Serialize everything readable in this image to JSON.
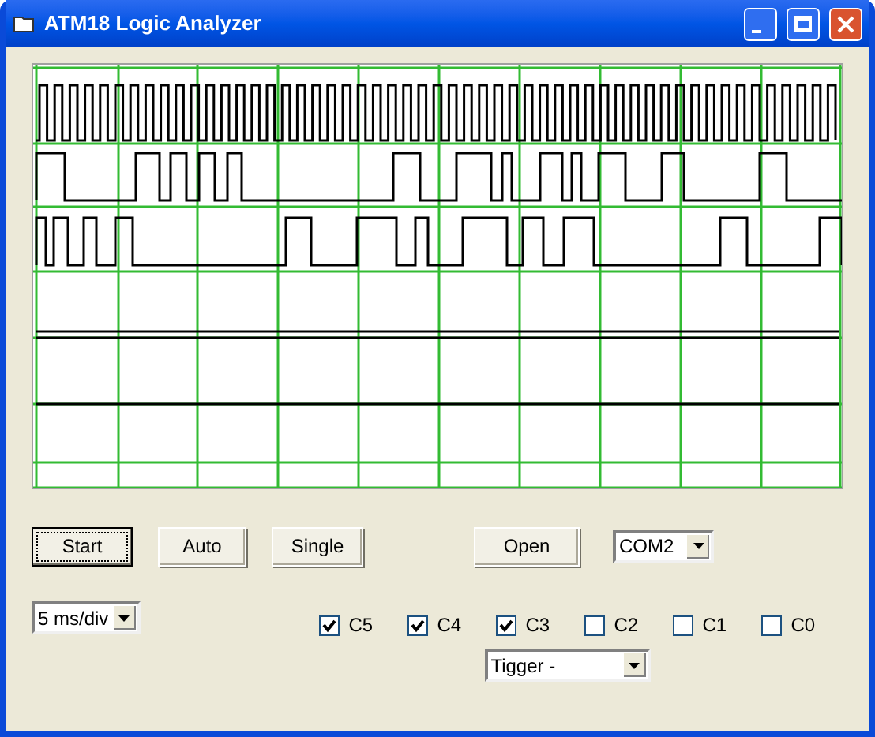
{
  "window": {
    "title": "ATM18 Logic Analyzer"
  },
  "buttons": [
    {
      "label": "Start",
      "focused": true
    },
    {
      "label": "Auto",
      "focused": false
    },
    {
      "label": "Single",
      "focused": false
    }
  ],
  "open_button": {
    "label": "Open"
  },
  "port_select": {
    "value": "COM2"
  },
  "timebase_select": {
    "value": "5 ms/div"
  },
  "channels": [
    {
      "label": "C5",
      "checked": true
    },
    {
      "label": "C4",
      "checked": true
    },
    {
      "label": "C3",
      "checked": true
    },
    {
      "label": "C2",
      "checked": false
    },
    {
      "label": "C1",
      "checked": false
    },
    {
      "label": "C0",
      "checked": false
    }
  ],
  "trigger_select": {
    "value": "Tigger -"
  }
}
